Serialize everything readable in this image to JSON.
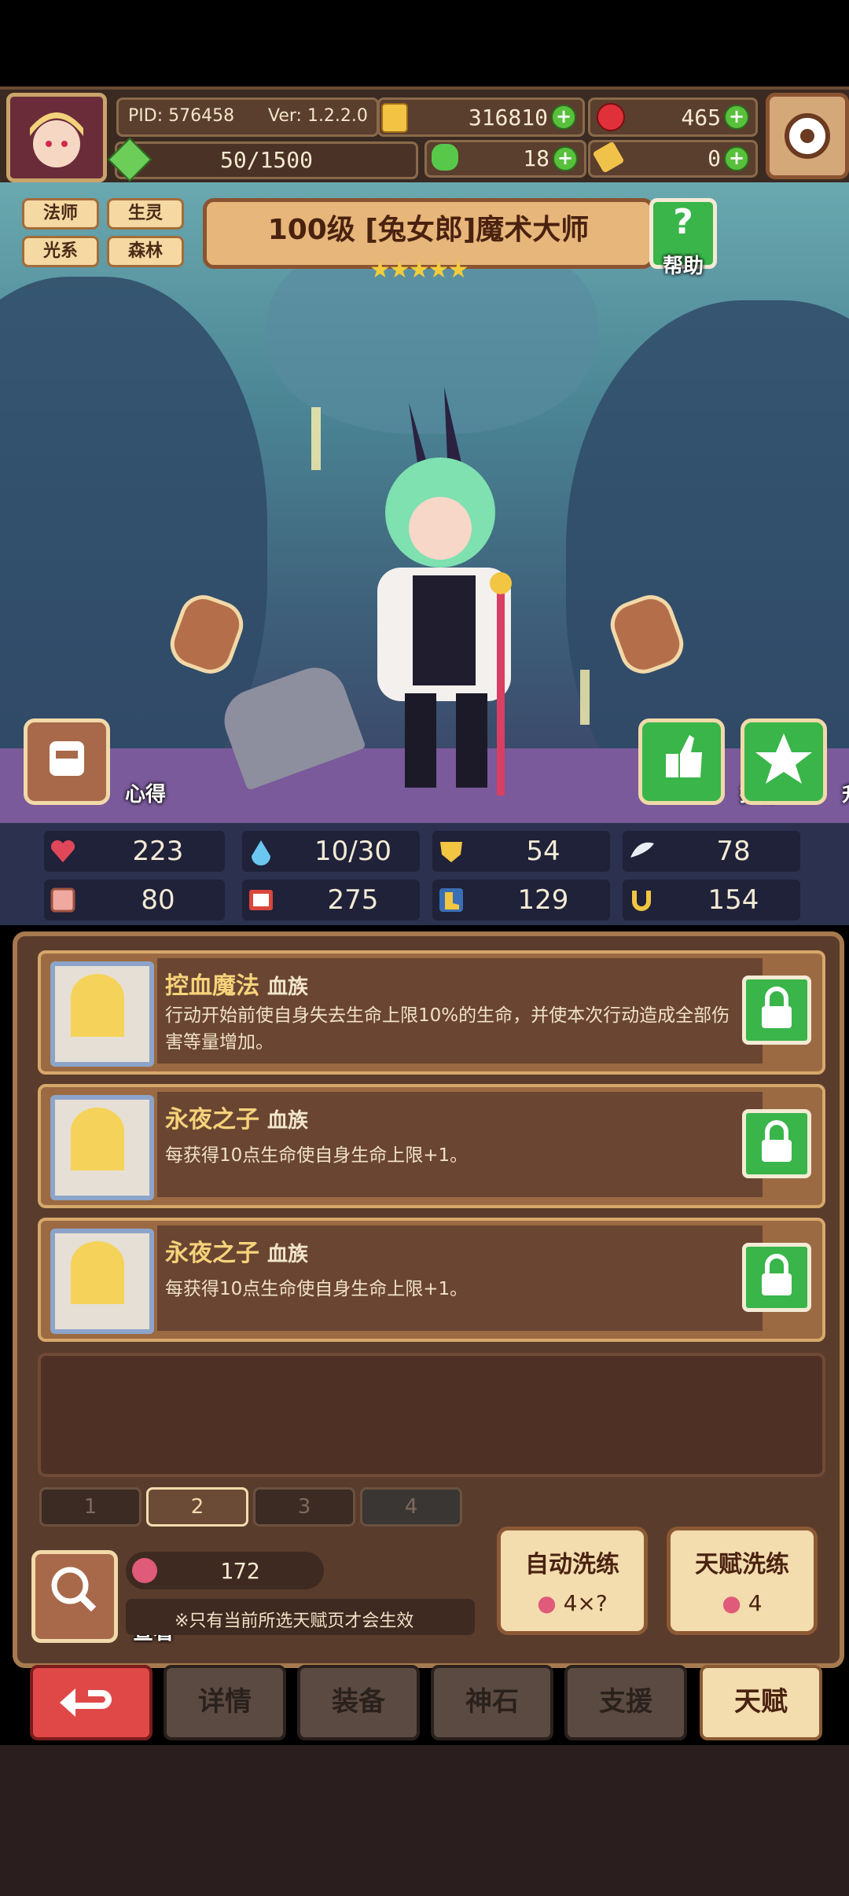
{
  "header": {
    "pid": "PID: 576458",
    "version": "Ver: 1.2.2.0",
    "gold": "316810",
    "gems": "465",
    "energy": "50/1500",
    "clover": "18",
    "ticket": "0"
  },
  "character": {
    "tags": [
      "法师",
      "生灵",
      "光系",
      "森林"
    ],
    "title": "100级 [兔女郎]魔术大师",
    "stars": 5,
    "help_label": "帮助",
    "left_button": "心得",
    "recommend_button": "推荐",
    "star_up_button": "升星"
  },
  "stats": {
    "hp": "223",
    "mana": "10/30",
    "shield": "54",
    "speed": "78",
    "attack": "80",
    "magic": "275",
    "defense": "129",
    "luck": "154"
  },
  "talents": [
    {
      "name": "控血魔法",
      "race": "血族",
      "desc": "行动开始前使自身失去生命上限10%的生命，并使本次行动造成全部伤害等量增加。"
    },
    {
      "name": "永夜之子",
      "race": "血族",
      "desc": "每获得10点生命使自身生命上限+1。"
    },
    {
      "name": "永夜之子",
      "race": "血族",
      "desc": "每获得10点生命使自身生命上限+1。"
    }
  ],
  "pages": [
    "1",
    "2",
    "3",
    "4"
  ],
  "active_page": "2",
  "footer_panel": {
    "view_label": "查看",
    "fruit_count": "172",
    "note": "※只有当前所选天赋页才会生效",
    "auto_refine_label": "自动洗练",
    "auto_refine_cost": "4×?",
    "talent_refine_label": "天赋洗练",
    "talent_refine_cost": "4"
  },
  "nav": {
    "details": "详情",
    "equipment": "装备",
    "godstone": "神石",
    "support": "支援",
    "talent": "天赋"
  },
  "colors": {
    "accent_green": "#39b54a",
    "panel_brown": "#5a3c2c",
    "gold_text": "#f6d27a",
    "back_red": "#e04848"
  }
}
